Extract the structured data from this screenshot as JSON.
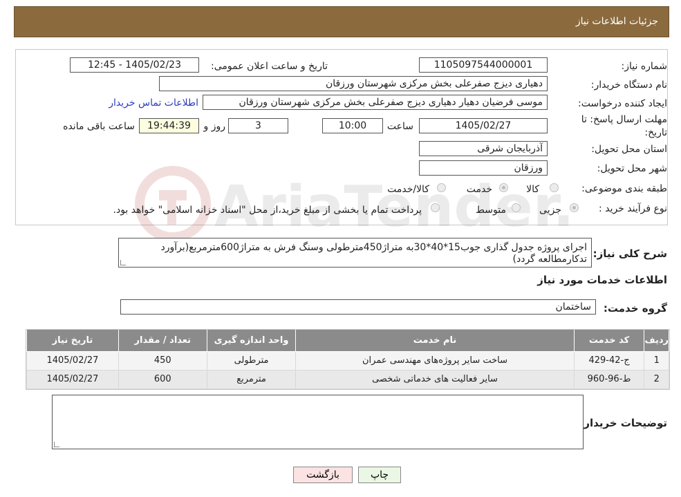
{
  "header": {
    "title": "جزئیات اطلاعات نیاز"
  },
  "form": {
    "need_number_label": "شماره نیاز:",
    "need_number": "1105097544000001",
    "announce_label": "تاریخ و ساعت اعلان عمومی:",
    "announce_value": "1405/02/23 - 12:45",
    "buyer_org_label": "نام دستگاه خریدار:",
    "buyer_org": "دهیاری دیزج صفرعلی بخش مرکزی شهرستان ورزقان",
    "creator_label": "ایجاد کننده درخواست:",
    "creator": "موسی فرضیان دهیار دهیاری دیزج صفرعلی بخش مرکزی شهرستان ورزقان",
    "contact_link": "اطلاعات تماس خریدار",
    "deadline_label_line1": "مهلت ارسال پاسخ: تا",
    "deadline_label_line2": "تاریخ:",
    "deadline_date": "1405/02/27",
    "time_label": "ساعت",
    "deadline_time": "10:00",
    "days_value": "3",
    "days_label": "روز و",
    "remaining_time": "19:44:39",
    "remaining_label": "ساعت باقی مانده",
    "province_label": "استان محل تحویل:",
    "province": "آذربایجان شرقی",
    "city_label": "شهر محل تحویل:",
    "city": "ورزقان",
    "category_label": "طبقه بندی موضوعی:",
    "category_options": [
      "کالا",
      "خدمت",
      "کالا/خدمت"
    ],
    "process_label": "نوع فرآیند خرید :",
    "process_options": [
      "جزیی",
      "متوسط"
    ],
    "process_note": "پرداخت تمام یا بخشی از مبلغ خرید،از محل \"اسناد خزانه اسلامی\" خواهد بود."
  },
  "summary": {
    "label": "شرح کلی نیاز:",
    "text": "اجرای پروژه جدول گذاری جوب15*40*30به متراژ450مترطولی وسنگ فرش به متراژ600مترمربع(برآورد تدکارمطالعه گردد)"
  },
  "services": {
    "section_title": "اطلاعات خدمات مورد نیاز",
    "group_label": "گروه خدمت:",
    "group_value": "ساختمان",
    "columns": [
      "ردیف",
      "کد خدمت",
      "نام خدمت",
      "واحد اندازه گیری",
      "تعداد / مقدار",
      "تاریخ نیاز"
    ],
    "rows": [
      {
        "index": "1",
        "code": "ج-42-429",
        "name": "ساخت سایر پروژه‌های مهندسی عمران",
        "unit": "مترطولی",
        "qty": "450",
        "date": "1405/02/27"
      },
      {
        "index": "2",
        "code": "ط-96-960",
        "name": "سایر فعالیت های خدماتی شخصی",
        "unit": "مترمربع",
        "qty": "600",
        "date": "1405/02/27"
      }
    ]
  },
  "notes": {
    "label": "توضیحات خریدار:"
  },
  "buttons": {
    "print": "چاپ",
    "back": "بازگشت"
  },
  "colors": {
    "header": "#8b6a3e",
    "table_header": "#8b8b8b",
    "link": "#2a3dbb",
    "print_btn": "#eaf7e4",
    "back_btn": "#fbe3e3"
  }
}
